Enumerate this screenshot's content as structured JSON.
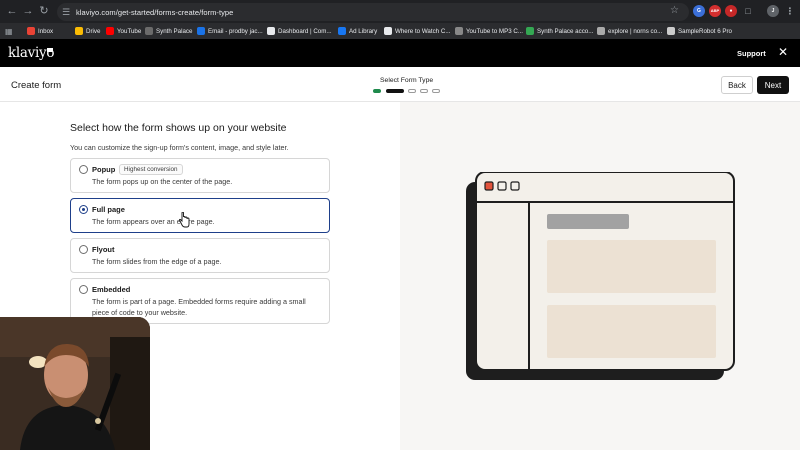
{
  "browser": {
    "url": "klaviyo.com/get-started/forms-create/form-type",
    "bookmarks": [
      {
        "label": "Inbox",
        "icon": "gmail-icon",
        "color": "#ea4335"
      },
      {
        "label": "Drive",
        "icon": "drive-icon",
        "color": "#fbbc04"
      },
      {
        "label": "YouTube",
        "icon": "youtube-icon",
        "color": "#ff0000"
      },
      {
        "label": "Synth Palace",
        "icon": "synth-palace-icon",
        "color": "#6b6b6b"
      },
      {
        "label": "Email - prodby jac...",
        "icon": "email-icon",
        "color": "#1a73e8"
      },
      {
        "label": "Dashboard | Com...",
        "icon": "dashboard-icon",
        "color": "#e8eaed"
      },
      {
        "label": "Ad Library",
        "icon": "meta-icon",
        "color": "#1877f2"
      },
      {
        "label": "Where to Watch C...",
        "icon": "justwatch-icon",
        "color": "#e8eaed"
      },
      {
        "label": "YouTube to MP3 C...",
        "icon": "converter-icon",
        "color": "#888"
      },
      {
        "label": "Synth Palace acco...",
        "icon": "sheets-icon",
        "color": "#34a853"
      },
      {
        "label": "explore | norns co...",
        "icon": "norns-icon",
        "color": "#aaa"
      },
      {
        "label": "SampleRobot 6 Pro",
        "icon": "samplerobot-icon",
        "color": "#ccc"
      }
    ]
  },
  "header": {
    "logo": "klaviyo",
    "support": "Support"
  },
  "toolbar": {
    "title": "Create form",
    "step_label": "Select Form Type",
    "back": "Back",
    "next": "Next"
  },
  "main": {
    "heading": "Select how the form shows up on your website",
    "subheading": "You can customize the sign-up form's content, image, and style later.",
    "options": [
      {
        "title": "Popup",
        "badge": "Highest conversion",
        "desc": "The form pops up on the center of the page.",
        "selected": false
      },
      {
        "title": "Full page",
        "desc": "The form appears over an entire page.",
        "selected": true
      },
      {
        "title": "Flyout",
        "desc": "The form slides from the edge of a page.",
        "selected": false
      },
      {
        "title": "Embedded",
        "desc": "The form is part of a page. Embedded forms require adding a small piece of code to your website.",
        "selected": false
      }
    ]
  },
  "colors": {
    "accent": "#1e3f8a",
    "step_done": "#1f8a4c",
    "illustration_dot_red": "#e2533c"
  }
}
